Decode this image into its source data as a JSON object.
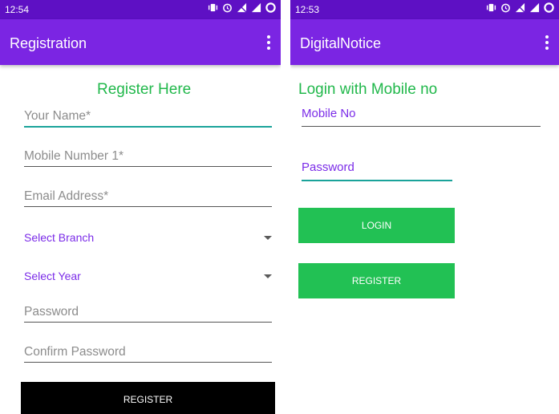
{
  "colors": {
    "statusbar": "#5e10c4",
    "appbar": "#7b25e3",
    "heading_green": "#21b84b",
    "accent_purple": "#7b2ce8",
    "button_green": "#22c154",
    "button_black": "#000000",
    "focus_underline": "#1aa39a"
  },
  "left": {
    "status": {
      "time": "12:54",
      "icons": [
        "vibrate-icon",
        "alarm-icon",
        "no-sim-icon",
        "signal-icon",
        "data-saver-icon"
      ]
    },
    "appbar": {
      "title": "Registration",
      "menu_icon": "overflow-menu-icon"
    },
    "heading": "Register Here",
    "fields": {
      "name": "Your Name*",
      "mobile": "Mobile Number 1*",
      "email": "Email Address*",
      "password": "Password",
      "confirm": "Confirm Password"
    },
    "selects": {
      "branch": "Select Branch",
      "year": "Select Year"
    },
    "register_button": "REGISTER"
  },
  "right": {
    "status": {
      "time": "12:53",
      "icons": [
        "vibrate-icon",
        "alarm-icon",
        "no-sim-icon",
        "signal-icon",
        "data-saver-icon"
      ]
    },
    "appbar": {
      "title": "DigitalNotice",
      "menu_icon": "overflow-menu-icon"
    },
    "heading": "Login with Mobile no",
    "fields": {
      "mobile": "Mobile No",
      "password": "Password"
    },
    "login_button": "LOGIN",
    "register_button": "REGISTER"
  }
}
